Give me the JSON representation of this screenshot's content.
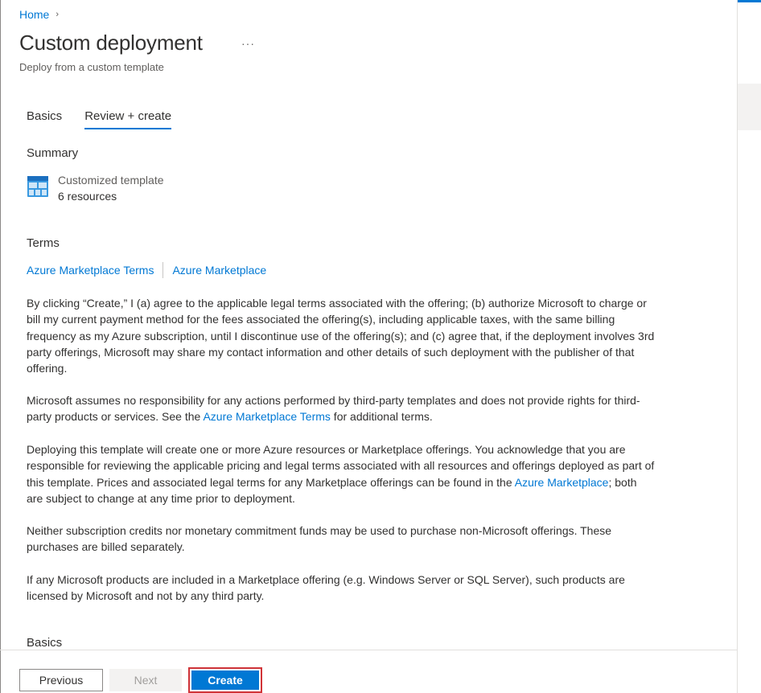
{
  "breadcrumb": {
    "home": "Home",
    "chevron": "›"
  },
  "header": {
    "title": "Custom deployment",
    "more": "···",
    "subtitle": "Deploy from a custom template"
  },
  "tabs": [
    {
      "label": "Basics",
      "active": false
    },
    {
      "label": "Review + create",
      "active": true
    }
  ],
  "summary": {
    "heading": "Summary",
    "icon": "template-icon",
    "line1": "Customized template",
    "line2": "6 resources"
  },
  "terms": {
    "heading": "Terms",
    "link1": "Azure Marketplace Terms",
    "link2": "Azure Marketplace",
    "p1": "By clicking “Create,” I (a) agree to the applicable legal terms associated with the offering; (b) authorize Microsoft to charge or bill my current payment method for the fees associated the offering(s), including applicable taxes, with the same billing frequency as my Azure subscription, until I discontinue use of the offering(s); and (c) agree that, if the deployment involves 3rd party offerings, Microsoft may share my contact information and other details of such deployment with the publisher of that offering.",
    "p2_before": "Microsoft assumes no responsibility for any actions performed by third-party templates and does not provide rights for third-party products or services. See the ",
    "p2_link": "Azure Marketplace Terms",
    "p2_after": " for additional terms.",
    "p3_before": "Deploying this template will create one or more Azure resources or Marketplace offerings.  You acknowledge that you are responsible for reviewing the applicable pricing and legal terms associated with all resources and offerings deployed as part of this template.  Prices and associated legal terms for any Marketplace offerings can be found in the ",
    "p3_link": "Azure Marketplace",
    "p3_after": "; both are subject to change at any time prior to deployment.",
    "p4": "Neither subscription credits nor monetary commitment funds may be used to purchase non-Microsoft offerings. These purchases are billed separately.",
    "p5": "If any Microsoft products are included in a Marketplace offering (e.g. Windows Server or SQL Server), such products are licensed by Microsoft and not by any third party."
  },
  "basics_heading": "Basics",
  "footer": {
    "previous": "Previous",
    "next": "Next",
    "create": "Create"
  },
  "colors": {
    "accent": "#0078d4",
    "highlight_border": "#d13438",
    "text": "#323130",
    "muted": "#605e5c"
  }
}
